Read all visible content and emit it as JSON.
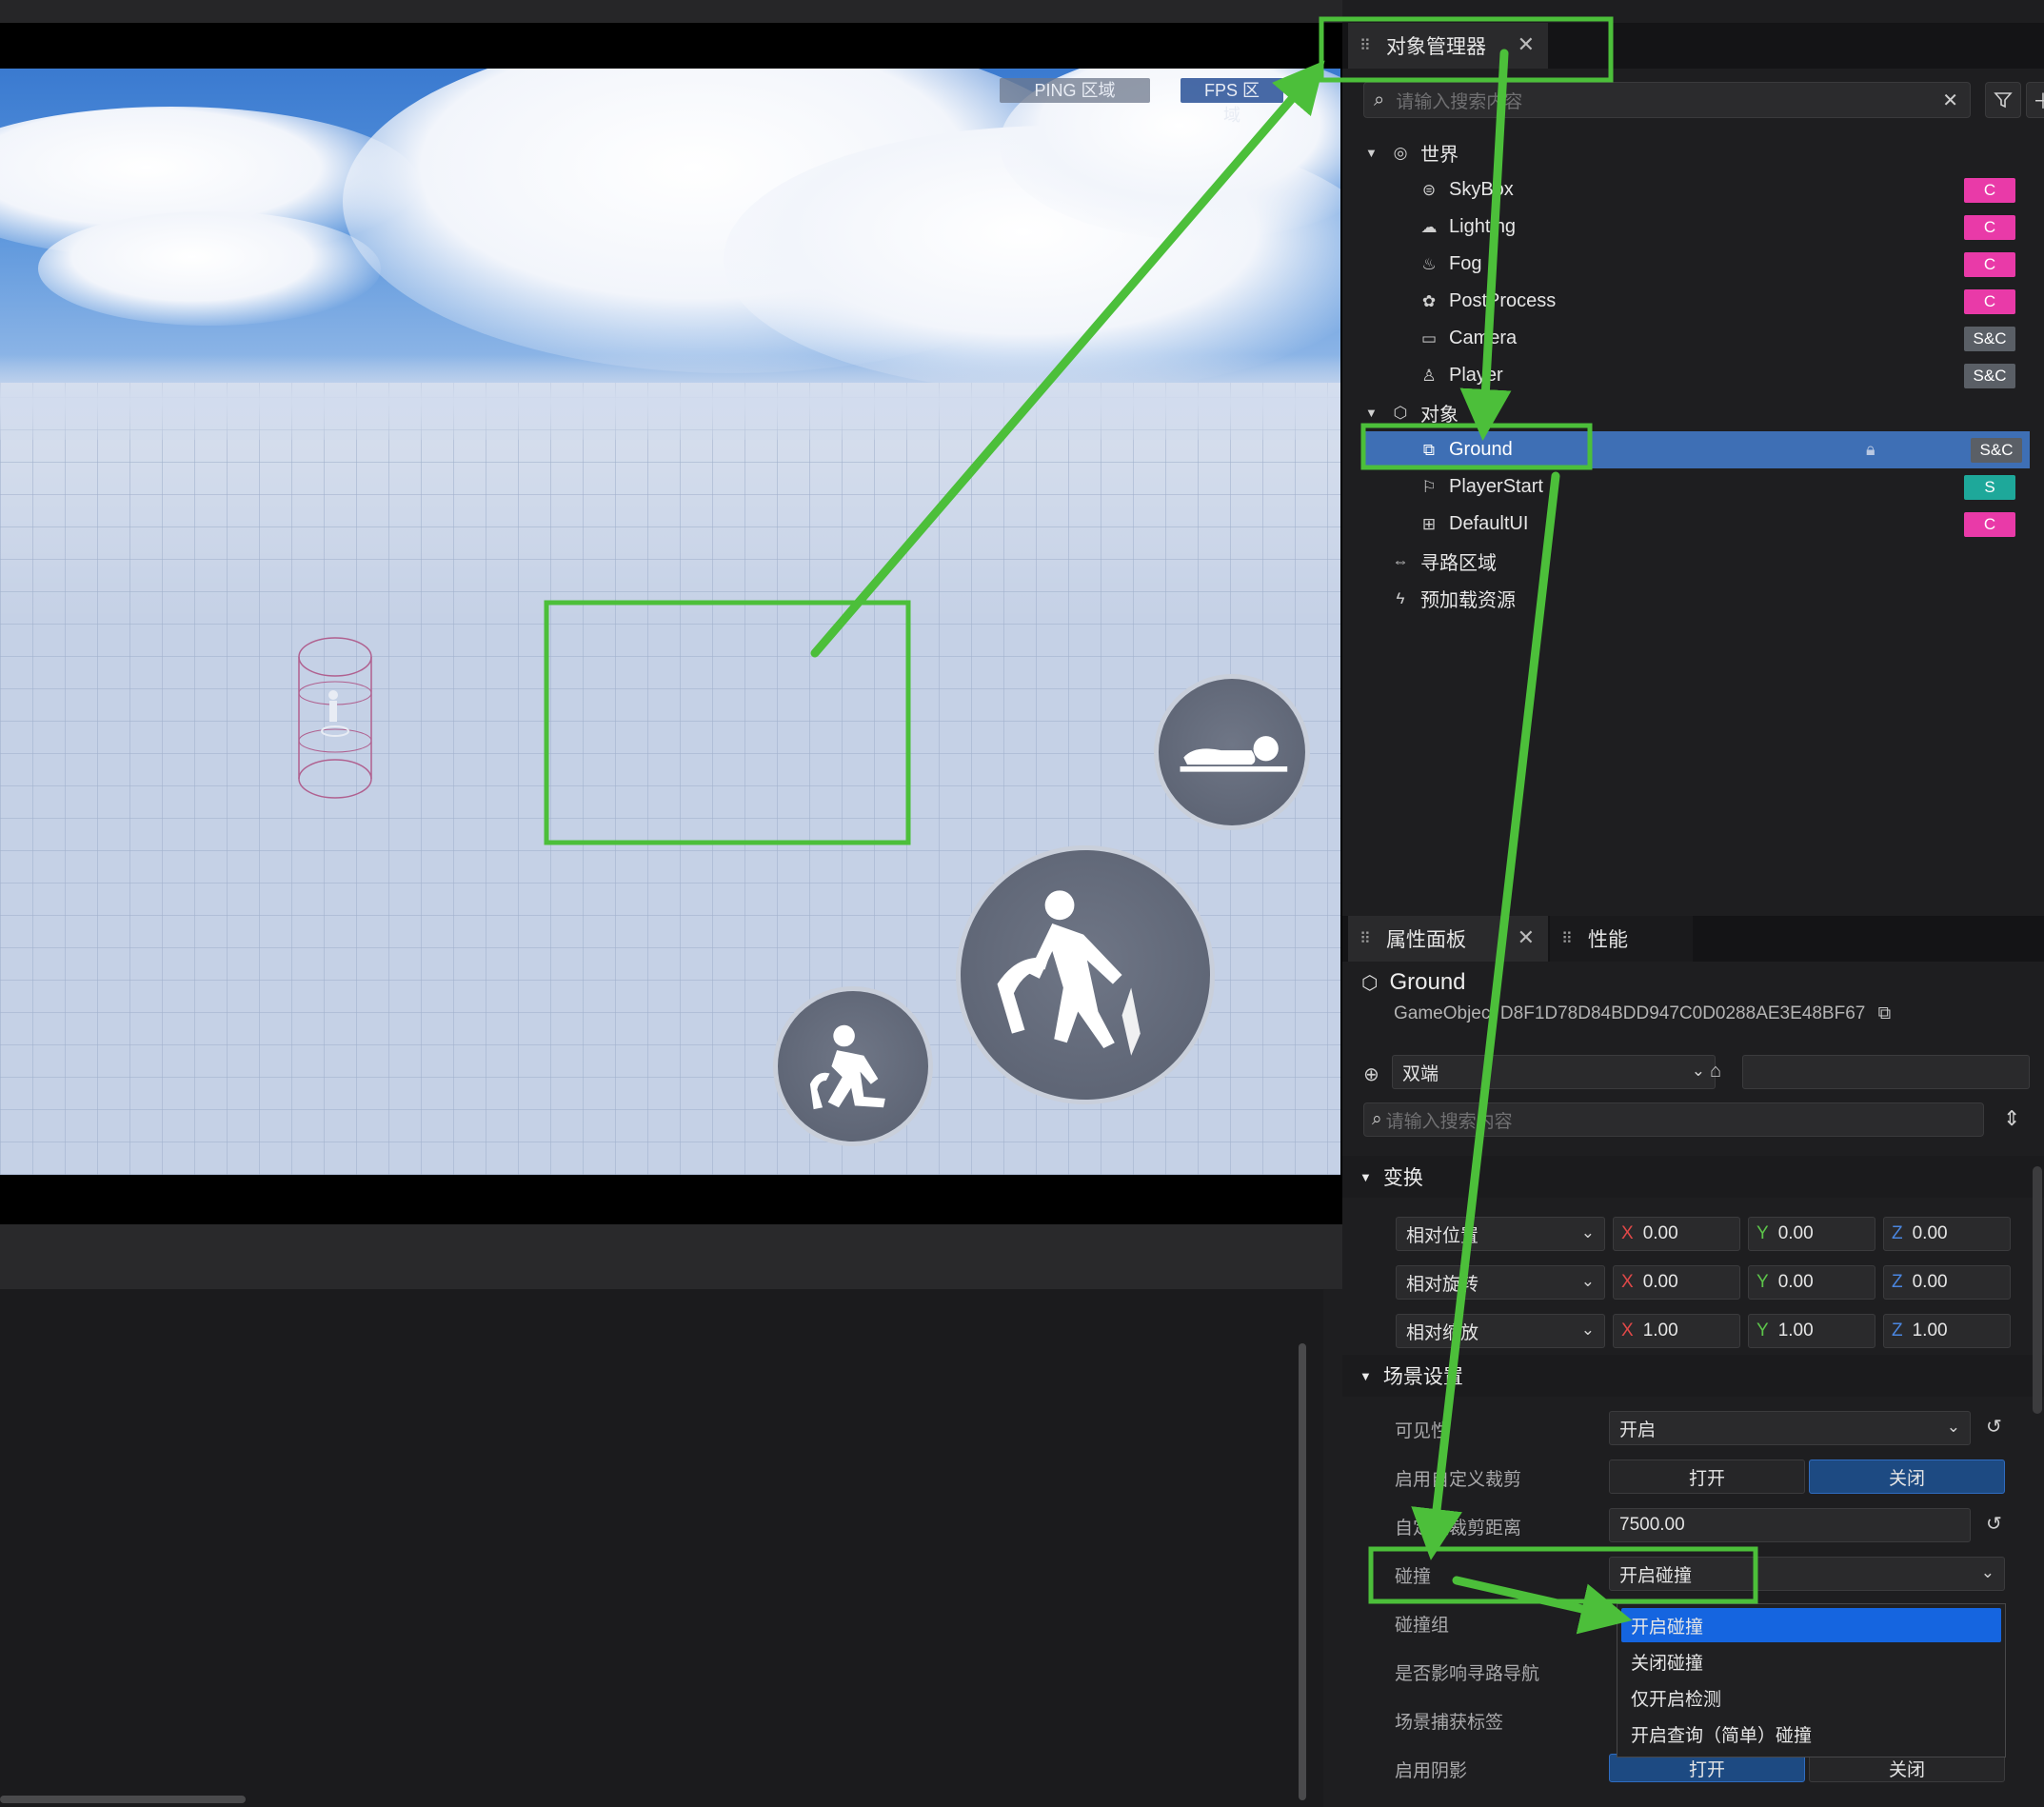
{
  "viewport": {
    "ping_label": "PING 区域",
    "fps_label": "FPS 区域"
  },
  "object_manager": {
    "tab_label": "对象管理器",
    "search_placeholder": "请输入搜索内容",
    "tree": [
      {
        "label": "世界",
        "icon": "globe-icon",
        "tag": ""
      },
      {
        "label": "SkyBox",
        "icon": "skybox-icon",
        "tag": "C"
      },
      {
        "label": "Lighting",
        "icon": "cloud-icon",
        "tag": "C"
      },
      {
        "label": "Fog",
        "icon": "fog-icon",
        "tag": "C"
      },
      {
        "label": "PostProcess",
        "icon": "palette-icon",
        "tag": "C"
      },
      {
        "label": "Camera",
        "icon": "camera-icon",
        "tag": "S&C"
      },
      {
        "label": "Player",
        "icon": "player-icon",
        "tag": "S&C"
      },
      {
        "label": "对象",
        "icon": "cube-icon",
        "tag": ""
      },
      {
        "label": "Ground",
        "icon": "ground-icon",
        "tag": "S&C"
      },
      {
        "label": "PlayerStart",
        "icon": "flag-icon",
        "tag": "S"
      },
      {
        "label": "DefaultUI",
        "icon": "ui-icon",
        "tag": "C"
      },
      {
        "label": "寻路区域",
        "icon": "navmesh-icon",
        "tag": ""
      },
      {
        "label": "预加载资源",
        "icon": "lightning-icon",
        "tag": ""
      }
    ]
  },
  "properties": {
    "tab_label": "属性面板",
    "perf_tab_label": "性能",
    "object_name": "Ground",
    "guid": "GameObject D8F1D78D84BDD947C0D0288AE3E48BF67",
    "net_mode": "双端",
    "search_placeholder": "请输入搜索内容",
    "transform_header": "变换",
    "transform_rows": [
      {
        "label": "相对位置",
        "x": "0.00",
        "y": "0.00",
        "z": "0.00"
      },
      {
        "label": "相对旋转",
        "x": "0.00",
        "y": "0.00",
        "z": "0.00"
      },
      {
        "label": "相对缩放",
        "x": "1.00",
        "y": "1.00",
        "z": "1.00"
      }
    ],
    "scene_header": "场景设置",
    "visible_label": "可见性",
    "visible_value": "开启",
    "custom_cull_label": "启用自定义裁剪",
    "open_label": "打开",
    "close_label": "关闭",
    "cull_dist_label": "自定义裁剪距离",
    "cull_dist_value": "7500.00",
    "collision_label": "碰撞",
    "collision_value": "开启碰撞",
    "collision_group_label": "碰撞组",
    "affect_nav_label": "是否影响寻路导航",
    "scene_capture_label": "场景捕获标签",
    "shadow_label": "启用阴影"
  },
  "collision_dropdown": {
    "options": [
      "开启碰撞",
      "关闭碰撞",
      "仅开启检测",
      "开启查询（简单）碰撞"
    ],
    "selected": 0
  },
  "colors": {
    "tag_c": "#e93aa8",
    "tag_sc": "#5a5f66",
    "tag_s": "#1ea89a",
    "selection": "#3e6fb5",
    "annotation": "#4cbf3a",
    "x_axis": "#e04848",
    "y_axis": "#5cc44a",
    "z_axis": "#4a86e0"
  }
}
